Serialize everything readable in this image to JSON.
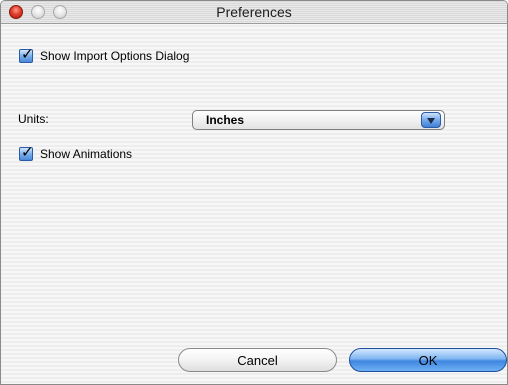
{
  "window": {
    "title": "Preferences",
    "controls": [
      "close-icon",
      "minimize-icon",
      "zoom-icon"
    ],
    "close_color": "#e0402b"
  },
  "options": {
    "show_import_dialog": {
      "label": "Show Import Options Dialog",
      "checked": true
    },
    "show_animations": {
      "label": "Show Animations",
      "checked": true
    }
  },
  "units": {
    "label": "Units:",
    "selected": "Inches",
    "arrow_icon": "chevron-down-icon"
  },
  "buttons": {
    "cancel": "Cancel",
    "ok": "OK",
    "accent": "#3e86e0"
  },
  "checkmark": "✓"
}
